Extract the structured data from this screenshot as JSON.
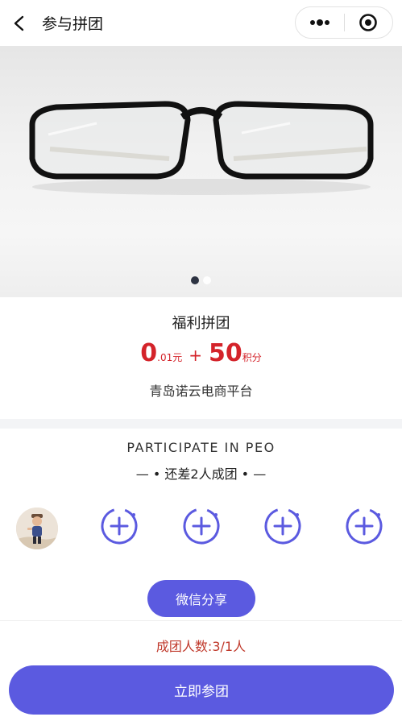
{
  "navbar": {
    "title": "参与拼团",
    "back_icon": "chevron-left-icon",
    "more_icon": "more-dots-icon",
    "close_icon": "target-icon"
  },
  "banner": {
    "image": "eyeglasses-photo",
    "dots": 2,
    "active_dot": 1
  },
  "product": {
    "title": "福利拼团",
    "price_main": "0",
    "price_decimal": ".01元",
    "plus": "+",
    "points": "50",
    "points_unit": "积分",
    "platform": "青岛诺云电商平台"
  },
  "participate": {
    "heading": "PARTICIPATE IN PEO",
    "remain_text": "— • 还差2人成团 • —",
    "member_avatar": "child-photo-avatar",
    "slot_icon": "add-member-icon",
    "share_label": "微信分享"
  },
  "footer": {
    "group_count": "成团人数:3/1人",
    "join_label": "立即参团"
  },
  "colors": {
    "accent": "#5b5ae0",
    "price_red": "#d4232a",
    "count_red": "#c0392b"
  }
}
